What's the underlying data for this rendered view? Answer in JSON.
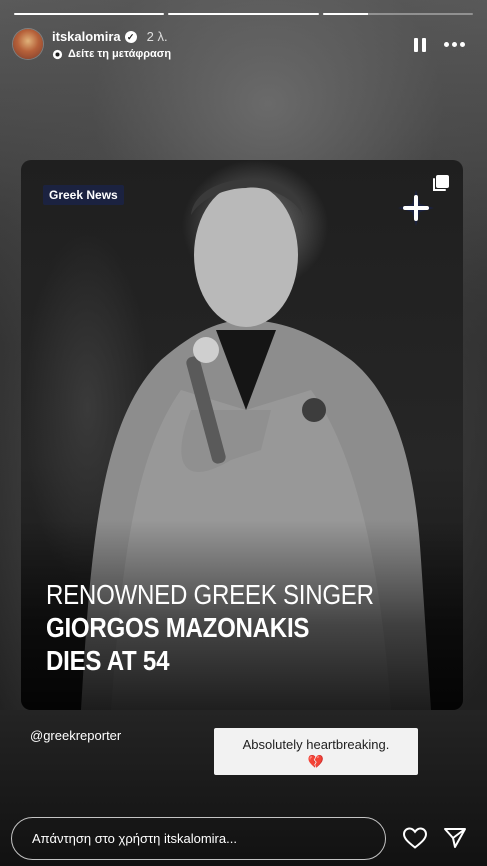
{
  "story": {
    "progress": [
      1,
      1,
      0.3
    ]
  },
  "header": {
    "username": "itskalomira",
    "time": "2 λ.",
    "translate_label": "Δείτε τη μετάφραση"
  },
  "card": {
    "badge": "Greek News",
    "headline_line1": "RENOWNED GREEK SINGER",
    "headline_line2": "GIORGOS MAZONAKIS",
    "headline_line3": "DIES AT 54"
  },
  "mention": "@greekreporter",
  "caption": {
    "text": "Absolutely heartbreaking.",
    "emoji": "💔"
  },
  "reply": {
    "placeholder": "Απάντηση στο χρήστη itskalomira..."
  },
  "colors": {
    "badge_bg": "#1b2240",
    "caption_bg": "#f2f2f2",
    "heart": "#b0253a"
  }
}
